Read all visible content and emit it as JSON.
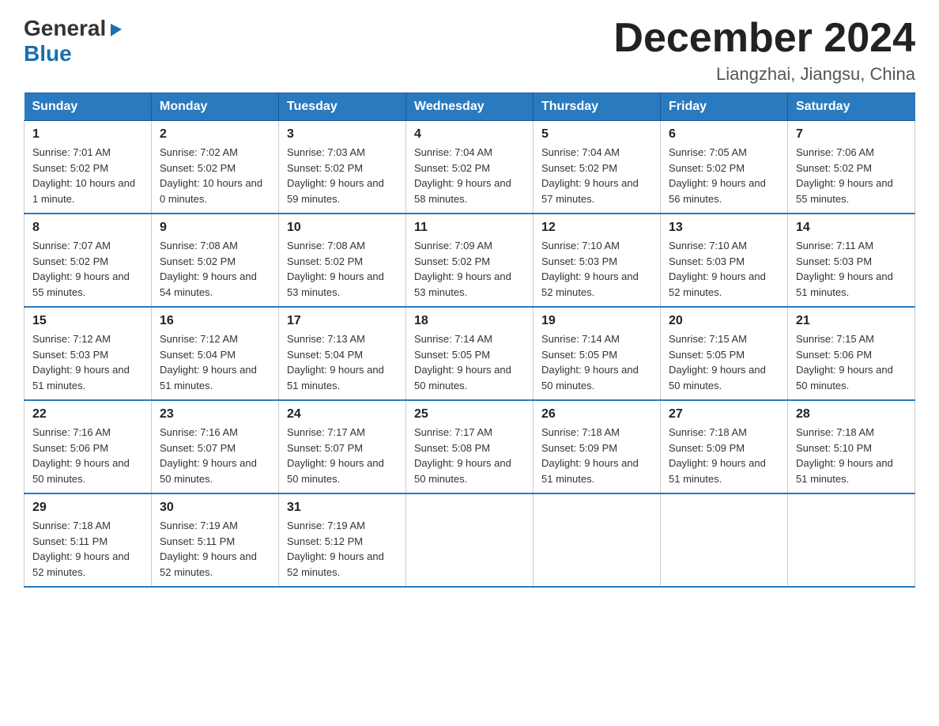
{
  "logo": {
    "general": "General",
    "blue": "Blue",
    "triangle": "▶"
  },
  "header": {
    "month_year": "December 2024",
    "location": "Liangzhai, Jiangsu, China"
  },
  "days_of_week": [
    "Sunday",
    "Monday",
    "Tuesday",
    "Wednesday",
    "Thursday",
    "Friday",
    "Saturday"
  ],
  "weeks": [
    [
      {
        "day": "1",
        "sunrise": "7:01 AM",
        "sunset": "5:02 PM",
        "daylight": "10 hours and 1 minute."
      },
      {
        "day": "2",
        "sunrise": "7:02 AM",
        "sunset": "5:02 PM",
        "daylight": "10 hours and 0 minutes."
      },
      {
        "day": "3",
        "sunrise": "7:03 AM",
        "sunset": "5:02 PM",
        "daylight": "9 hours and 59 minutes."
      },
      {
        "day": "4",
        "sunrise": "7:04 AM",
        "sunset": "5:02 PM",
        "daylight": "9 hours and 58 minutes."
      },
      {
        "day": "5",
        "sunrise": "7:04 AM",
        "sunset": "5:02 PM",
        "daylight": "9 hours and 57 minutes."
      },
      {
        "day": "6",
        "sunrise": "7:05 AM",
        "sunset": "5:02 PM",
        "daylight": "9 hours and 56 minutes."
      },
      {
        "day": "7",
        "sunrise": "7:06 AM",
        "sunset": "5:02 PM",
        "daylight": "9 hours and 55 minutes."
      }
    ],
    [
      {
        "day": "8",
        "sunrise": "7:07 AM",
        "sunset": "5:02 PM",
        "daylight": "9 hours and 55 minutes."
      },
      {
        "day": "9",
        "sunrise": "7:08 AM",
        "sunset": "5:02 PM",
        "daylight": "9 hours and 54 minutes."
      },
      {
        "day": "10",
        "sunrise": "7:08 AM",
        "sunset": "5:02 PM",
        "daylight": "9 hours and 53 minutes."
      },
      {
        "day": "11",
        "sunrise": "7:09 AM",
        "sunset": "5:02 PM",
        "daylight": "9 hours and 53 minutes."
      },
      {
        "day": "12",
        "sunrise": "7:10 AM",
        "sunset": "5:03 PM",
        "daylight": "9 hours and 52 minutes."
      },
      {
        "day": "13",
        "sunrise": "7:10 AM",
        "sunset": "5:03 PM",
        "daylight": "9 hours and 52 minutes."
      },
      {
        "day": "14",
        "sunrise": "7:11 AM",
        "sunset": "5:03 PM",
        "daylight": "9 hours and 51 minutes."
      }
    ],
    [
      {
        "day": "15",
        "sunrise": "7:12 AM",
        "sunset": "5:03 PM",
        "daylight": "9 hours and 51 minutes."
      },
      {
        "day": "16",
        "sunrise": "7:12 AM",
        "sunset": "5:04 PM",
        "daylight": "9 hours and 51 minutes."
      },
      {
        "day": "17",
        "sunrise": "7:13 AM",
        "sunset": "5:04 PM",
        "daylight": "9 hours and 51 minutes."
      },
      {
        "day": "18",
        "sunrise": "7:14 AM",
        "sunset": "5:05 PM",
        "daylight": "9 hours and 50 minutes."
      },
      {
        "day": "19",
        "sunrise": "7:14 AM",
        "sunset": "5:05 PM",
        "daylight": "9 hours and 50 minutes."
      },
      {
        "day": "20",
        "sunrise": "7:15 AM",
        "sunset": "5:05 PM",
        "daylight": "9 hours and 50 minutes."
      },
      {
        "day": "21",
        "sunrise": "7:15 AM",
        "sunset": "5:06 PM",
        "daylight": "9 hours and 50 minutes."
      }
    ],
    [
      {
        "day": "22",
        "sunrise": "7:16 AM",
        "sunset": "5:06 PM",
        "daylight": "9 hours and 50 minutes."
      },
      {
        "day": "23",
        "sunrise": "7:16 AM",
        "sunset": "5:07 PM",
        "daylight": "9 hours and 50 minutes."
      },
      {
        "day": "24",
        "sunrise": "7:17 AM",
        "sunset": "5:07 PM",
        "daylight": "9 hours and 50 minutes."
      },
      {
        "day": "25",
        "sunrise": "7:17 AM",
        "sunset": "5:08 PM",
        "daylight": "9 hours and 50 minutes."
      },
      {
        "day": "26",
        "sunrise": "7:18 AM",
        "sunset": "5:09 PM",
        "daylight": "9 hours and 51 minutes."
      },
      {
        "day": "27",
        "sunrise": "7:18 AM",
        "sunset": "5:09 PM",
        "daylight": "9 hours and 51 minutes."
      },
      {
        "day": "28",
        "sunrise": "7:18 AM",
        "sunset": "5:10 PM",
        "daylight": "9 hours and 51 minutes."
      }
    ],
    [
      {
        "day": "29",
        "sunrise": "7:18 AM",
        "sunset": "5:11 PM",
        "daylight": "9 hours and 52 minutes."
      },
      {
        "day": "30",
        "sunrise": "7:19 AM",
        "sunset": "5:11 PM",
        "daylight": "9 hours and 52 minutes."
      },
      {
        "day": "31",
        "sunrise": "7:19 AM",
        "sunset": "5:12 PM",
        "daylight": "9 hours and 52 minutes."
      },
      null,
      null,
      null,
      null
    ]
  ]
}
